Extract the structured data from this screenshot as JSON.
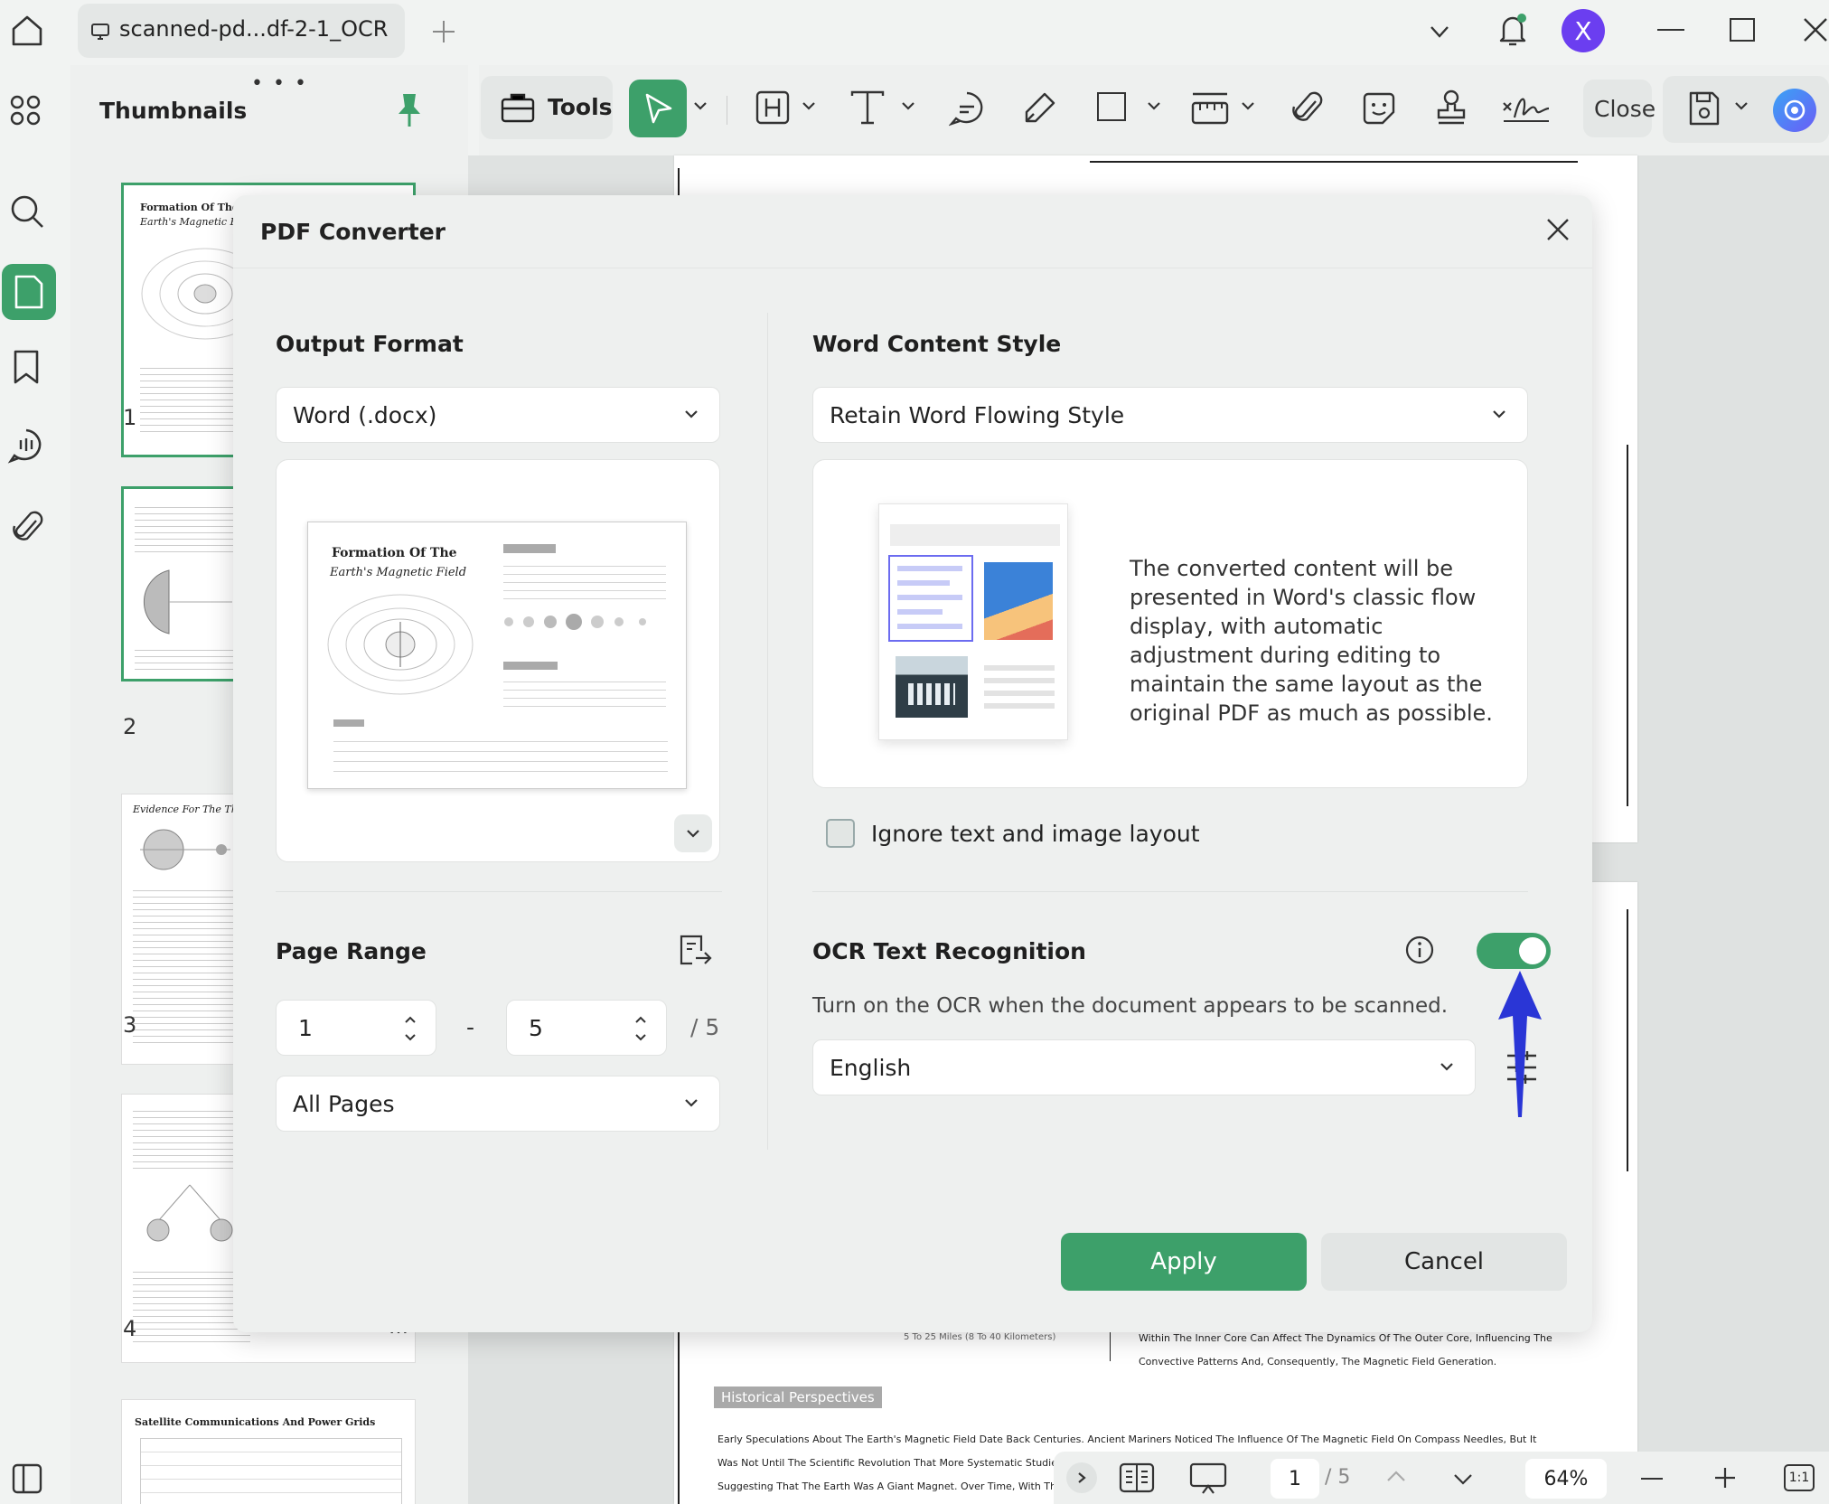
{
  "tab": {
    "title": "scanned-pd...df-2-1_OCR"
  },
  "window": {
    "avatar_letter": "X"
  },
  "thumbnails": {
    "title": "Thumbnails",
    "pages": [
      {
        "num": "1",
        "title": "Formation Of The",
        "subtitle": "Earth's Magnetic Field"
      },
      {
        "num": "2"
      },
      {
        "num": "3",
        "title": "Evidence For The The"
      },
      {
        "num": "4"
      },
      {
        "title": "Satellite Communications And Power Grids"
      }
    ]
  },
  "toolbar": {
    "tools_label": "Tools",
    "close_label": "Close"
  },
  "document": {
    "section_badge": "Historical Perspectives",
    "lines": [
      "Early Speculations About The Earth's Magnetic Field Date Back Centuries. Ancient Mariners Noticed The Influence Of The Magnetic Field On Compass Needles, But It",
      "Was Not Until The Scientific Revolution That More Systematic Studies Began. Sci",
      "Suggesting That The Earth Was A Giant Magnet. Over Time, With The Developm"
    ],
    "partial_left": "5 To 25 Miles (8 To 40 Kilometers)",
    "partial_right_1": "Within The Inner Core Can Affect The Dynamics Of The Outer Core, Influencing The",
    "partial_right_2": "Convective Patterns And, Consequently, The Magnetic Field Generation."
  },
  "statusbar": {
    "page": "1",
    "total": "/ 5",
    "zoom": "64%"
  },
  "dialog": {
    "title": "PDF Converter",
    "output_format": {
      "label": "Output Format",
      "value": "Word (.docx)",
      "preview_title": "Formation Of The",
      "preview_subtitle": "Earth's Magnetic Field"
    },
    "page_range": {
      "label": "Page Range",
      "from": "1",
      "to": "5",
      "total": "/ 5",
      "dash": "-",
      "subset": "All Pages"
    },
    "word_style": {
      "label": "Word Content Style",
      "value": "Retain Word Flowing Style",
      "description": "The converted content will be presented in Word's classic flow display, with automatic adjustment during editing to maintain the same layout as the original PDF as much as possible."
    },
    "ignore_layout": {
      "label": "Ignore text and image layout",
      "checked": false
    },
    "ocr": {
      "label": "OCR Text Recognition",
      "enabled": true,
      "hint": "Turn on the OCR when the document appears to be scanned.",
      "language": "English"
    },
    "apply_label": "Apply",
    "cancel_label": "Cancel"
  },
  "colors": {
    "accent": "#3da06a",
    "avatar": "#6b3ef0",
    "arrow": "#2a36d6"
  }
}
